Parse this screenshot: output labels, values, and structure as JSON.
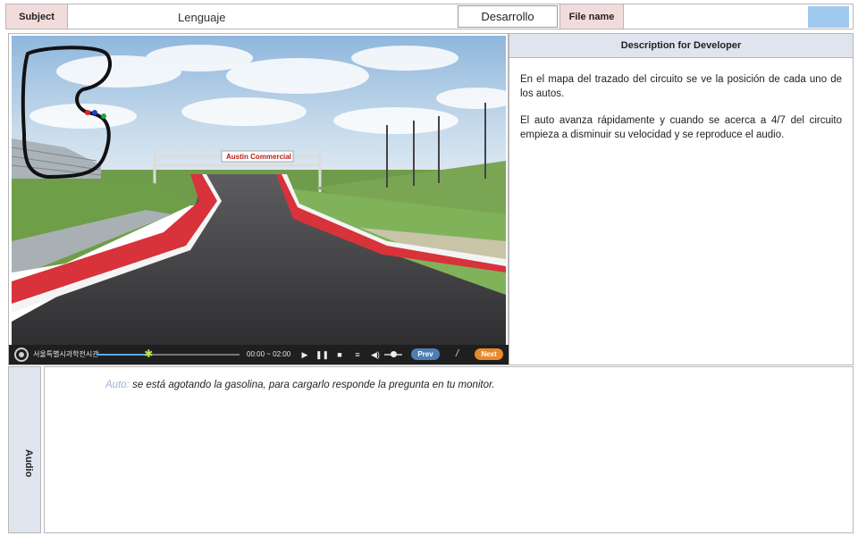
{
  "header": {
    "subject_label": "Subject",
    "subject_value": "Lenguaje",
    "stage": "Desarrollo",
    "filename_label": "File name",
    "filename_value": "",
    "filename_swatch_color": "#9fc9ee"
  },
  "screen": {
    "scene_banner": "Austin Commercial",
    "player": {
      "org_name": "서울특별시과학전시관",
      "time": "00:00 ~ 02:00",
      "progress": 0.37,
      "volume": 0.5,
      "prev_label": "Prev",
      "divider": "/",
      "next_label": "Next",
      "icons": [
        "play-icon",
        "pause-icon",
        "stop-icon",
        "list-icon",
        "volume-icon"
      ]
    }
  },
  "description": {
    "header": "Description for Developer",
    "paragraphs": [
      "En el mapa del trazado del circuito se ve la posición de cada uno de los autos.",
      "El auto avanza rápidamente y cuando se acerca a 4/7 del circuito empieza a disminuir su velocidad y se reproduce el audio."
    ]
  },
  "audio": {
    "side_label": "Audio",
    "speaker": "Auto:",
    "line": "se está agotando la gasolina, para cargarlo responde la pregunta en tu monitor."
  },
  "colors": {
    "label_bg": "#f2dcdb",
    "panel_header_bg": "#dfe4ef",
    "prev_button": "#4c7fb5",
    "next_button": "#e8892d"
  }
}
